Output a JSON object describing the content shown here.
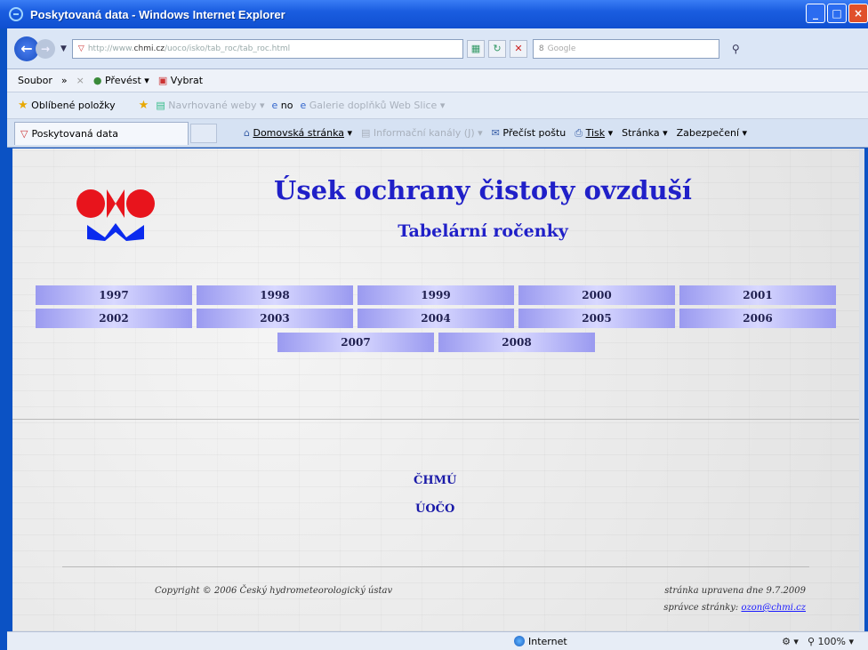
{
  "window": {
    "title": "Poskytovaná data - Windows Internet Explorer"
  },
  "address": {
    "url_prefix": "http://www.",
    "url_domain": "chmi.cz",
    "url_path": "/uoco/isko/tab_roc/tab_roc.html",
    "search_placeholder": "Google"
  },
  "menu": {
    "file": "Soubor",
    "more": "»",
    "translate": "Převést",
    "select": "Vybrat"
  },
  "favorites": {
    "favorites": "Oblíbené položky",
    "suggested": "Navrhované weby",
    "no": "no",
    "gallery": "Galerie doplňků Web Slice"
  },
  "tab": {
    "label": "Poskytovaná data"
  },
  "commands": {
    "home": "Domovská stránka",
    "feeds": "Informační kanály (J)",
    "mail": "Přečíst poštu",
    "print": "Tisk",
    "page": "Stránka",
    "safety": "Zabezpečení"
  },
  "page": {
    "title": "Úsek ochrany čistoty ovzduší",
    "subtitle": "Tabelární ročenky",
    "years": [
      "1997",
      "1998",
      "1999",
      "2000",
      "2001",
      "2002",
      "2003",
      "2004",
      "2005",
      "2006",
      "2007",
      "2008"
    ],
    "links": {
      "chmu": "ČHMÚ",
      "uoco": "ÚOČO"
    },
    "copyright": "Copyright © 2006 Český hydrometeorologický ústav",
    "updated": "stránka upravena dne 9.7.2009",
    "admin_label": "správce stránky:",
    "admin_email": "ozon@chmi.cz"
  },
  "status": {
    "zone": "Internet",
    "zoom": "100%"
  }
}
